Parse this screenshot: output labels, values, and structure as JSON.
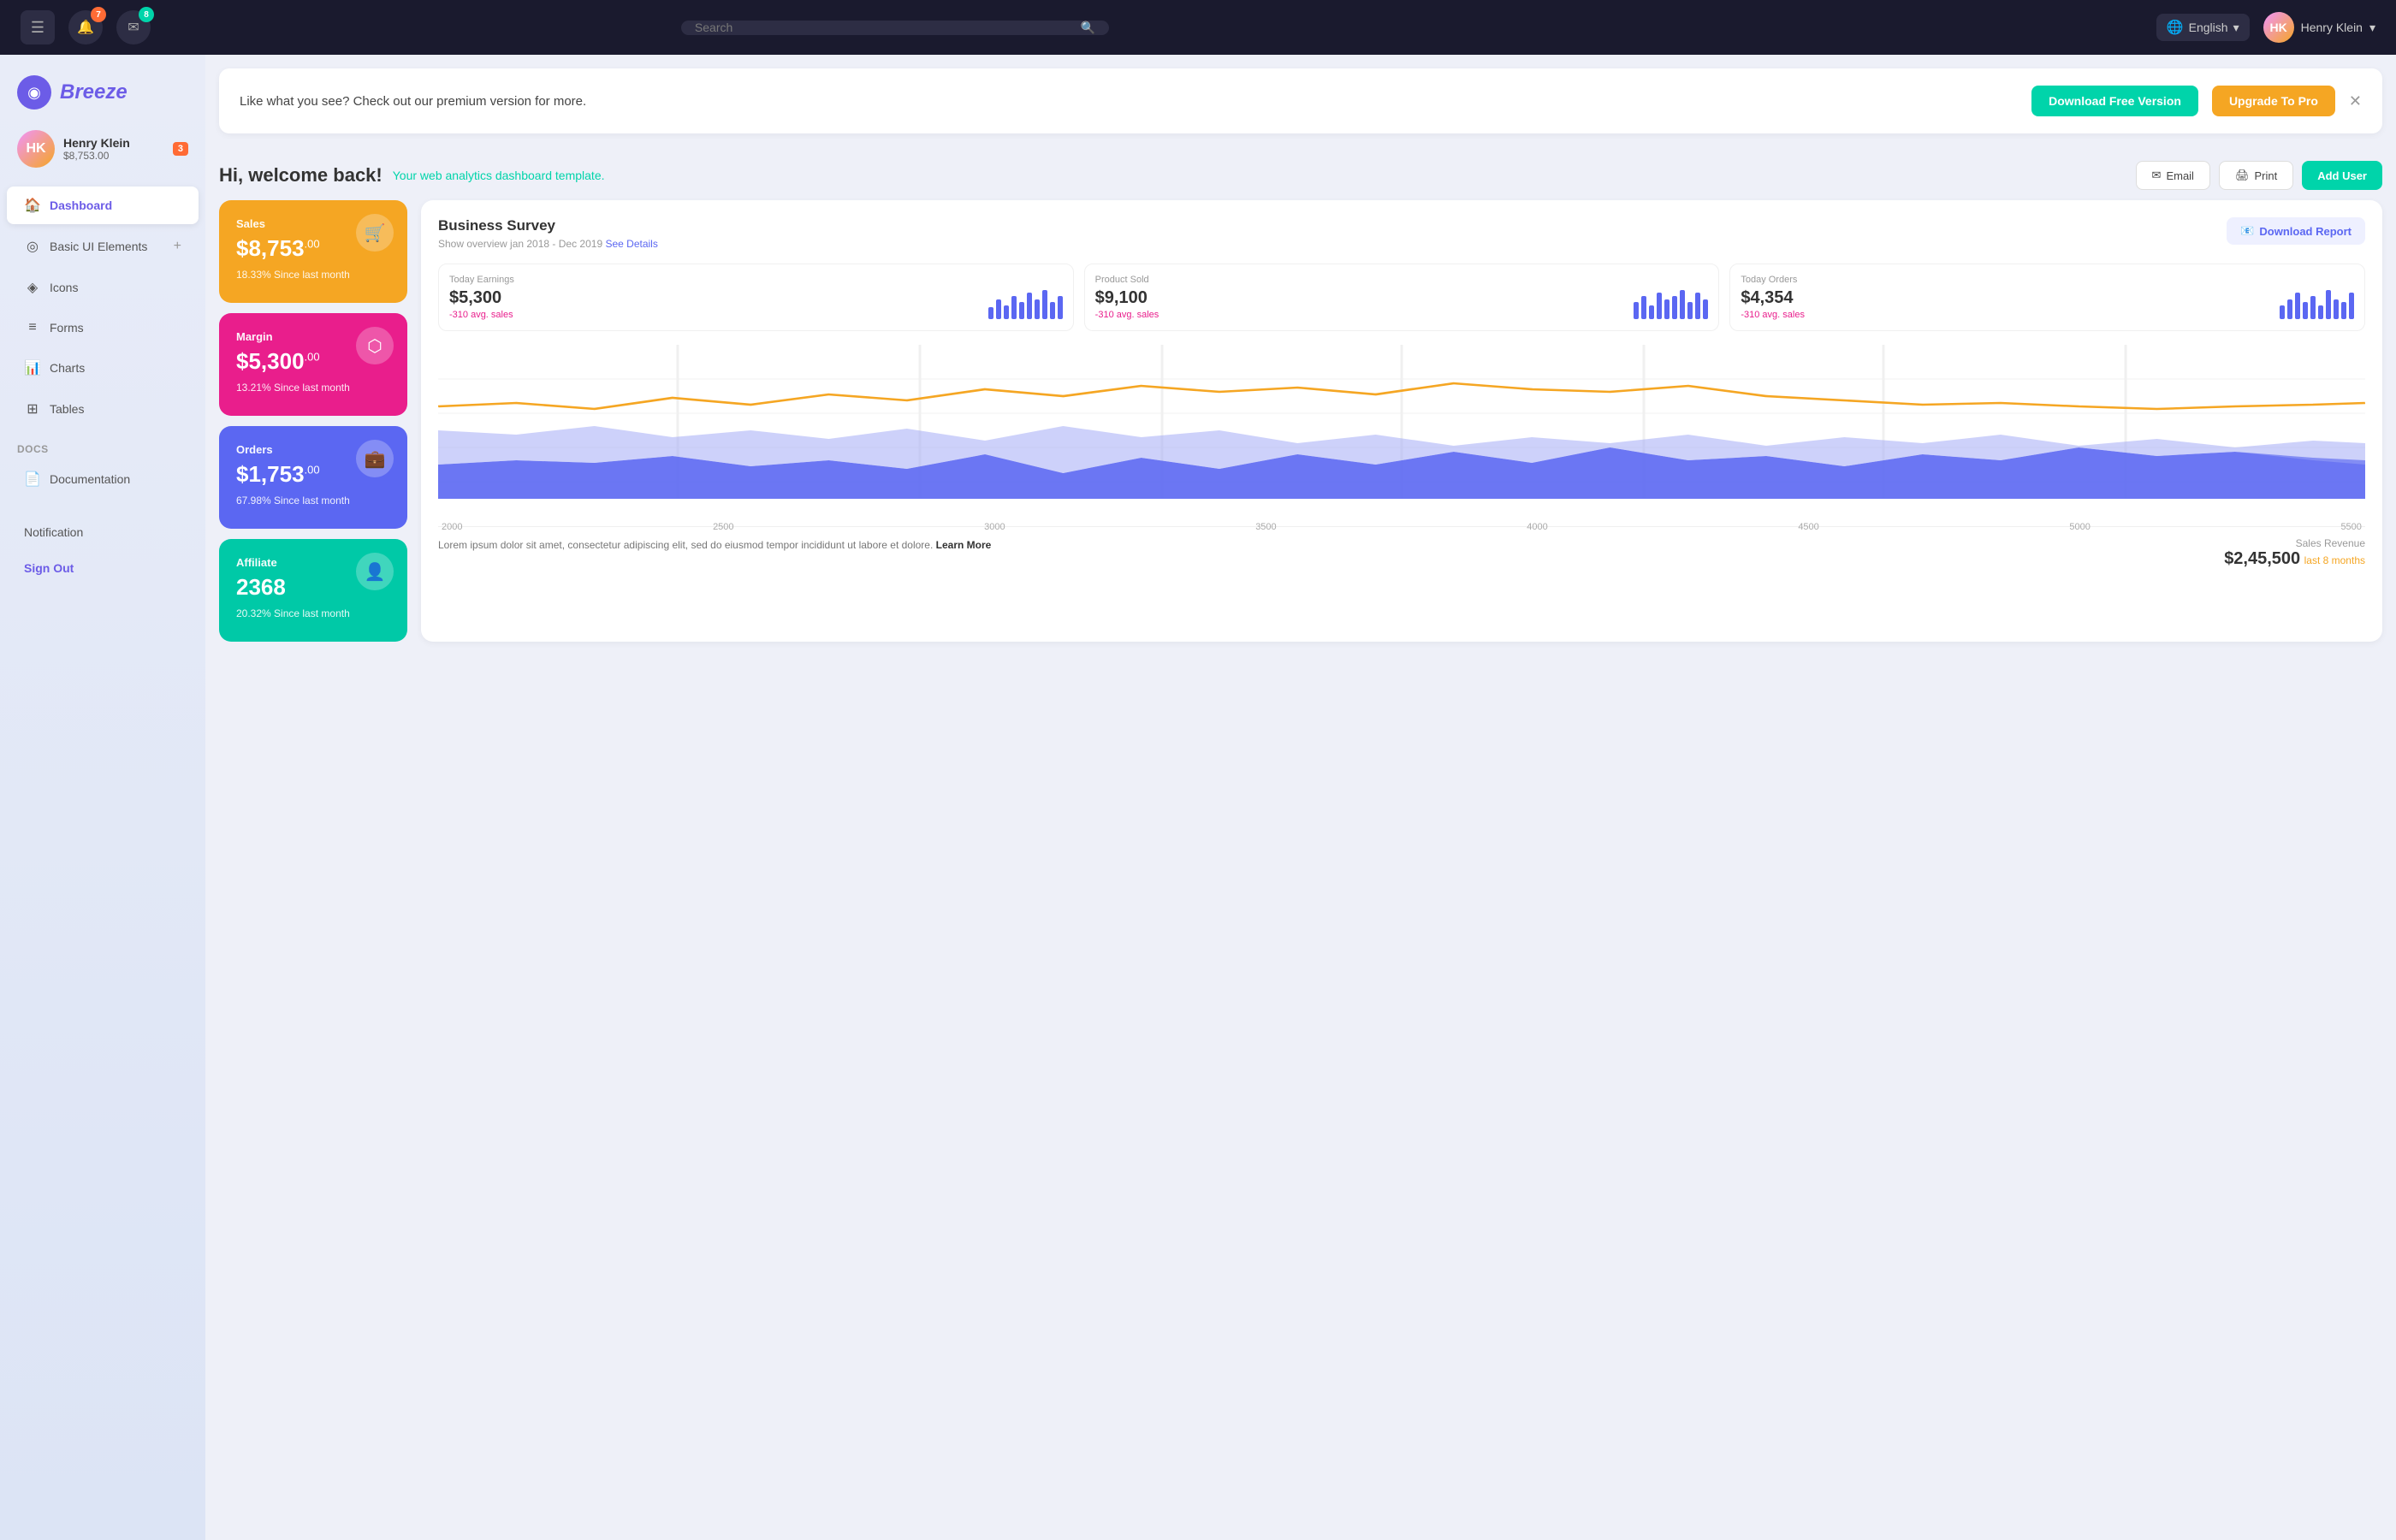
{
  "topNav": {
    "searchPlaceholder": "Search",
    "language": "English",
    "userName": "Henry Klein",
    "notifBadge": "7",
    "mailBadge": "8"
  },
  "sidebar": {
    "logoText": "Breeze",
    "user": {
      "name": "Henry Klein",
      "amount": "$8,753.00",
      "badgeCount": "3",
      "initials": "HK"
    },
    "navItems": [
      {
        "id": "dashboard",
        "label": "Dashboard",
        "icon": "🏠",
        "active": true
      },
      {
        "id": "basic-ui",
        "label": "Basic UI Elements",
        "icon": "◎",
        "active": false,
        "hasAdd": true
      },
      {
        "id": "icons",
        "label": "Icons",
        "icon": "◈",
        "active": false
      },
      {
        "id": "forms",
        "label": "Forms",
        "icon": "≡",
        "active": false
      },
      {
        "id": "charts",
        "label": "Charts",
        "icon": "📊",
        "active": false
      },
      {
        "id": "tables",
        "label": "Tables",
        "icon": "⊞",
        "active": false
      }
    ],
    "docsSectionLabel": "Docs",
    "docsItems": [
      {
        "id": "documentation",
        "label": "Documentation",
        "icon": "📄"
      }
    ],
    "notificationLabel": "Notification",
    "signOutLabel": "Sign Out"
  },
  "promoBanner": {
    "text": "Like what you see? Check out our premium version for more.",
    "downloadFreeBtn": "Download Free Version",
    "upgradeProBtn": "Upgrade To Pro"
  },
  "welcome": {
    "title": "Hi, welcome back!",
    "subtitle": "Your web analytics dashboard template.",
    "emailBtn": "Email",
    "printBtn": "Print",
    "addUserBtn": "Add User"
  },
  "statCards": [
    {
      "id": "sales",
      "label": "Sales",
      "value": "$8,753",
      "cents": ".00",
      "change": "18.33% Since last month",
      "color": "sales",
      "icon": "🛒"
    },
    {
      "id": "margin",
      "label": "Margin",
      "value": "$5,300",
      "cents": ".00",
      "change": "13.21% Since last month",
      "color": "margin",
      "icon": "⬡"
    },
    {
      "id": "orders",
      "label": "Orders",
      "value": "$1,753",
      "cents": ".00",
      "change": "67.98% Since last month",
      "color": "orders",
      "icon": "💼"
    },
    {
      "id": "affiliate",
      "label": "Affiliate",
      "value": "2368",
      "cents": "",
      "change": "20.32% Since last month",
      "color": "affiliate",
      "icon": "👤"
    }
  ],
  "businessSurvey": {
    "title": "Business Survey",
    "subtitle": "Show overview jan 2018 - Dec 2019",
    "seeDetailsLink": "See Details",
    "downloadReportBtn": "Download Report",
    "miniStats": [
      {
        "label": "Today Earnings",
        "value": "$5,300",
        "change": "-310 avg. sales",
        "bars": [
          3,
          6,
          4,
          7,
          5,
          8,
          6,
          9,
          5,
          7
        ]
      },
      {
        "label": "Product Sold",
        "value": "$9,100",
        "change": "-310 avg. sales",
        "bars": [
          5,
          7,
          4,
          8,
          6,
          7,
          9,
          5,
          8,
          6
        ]
      },
      {
        "label": "Today Orders",
        "value": "$4,354",
        "change": "-310 avg. sales",
        "bars": [
          4,
          6,
          8,
          5,
          7,
          4,
          9,
          6,
          5,
          8
        ]
      }
    ],
    "chartXLabels": [
      "2000",
      "2500",
      "3000",
      "3500",
      "4000",
      "4500",
      "5000",
      "5500"
    ],
    "footerText": "Lorem ipsum dolor sit amet, consectetur adipiscing elit, sed do eiusmod tempor incididunt ut labore et dolore.",
    "learnMoreLink": "Learn More",
    "salesRevenueLabel": "Sales Revenue",
    "salesRevenueValue": "$2,45,500",
    "salesRevenueSub": "last 8 months"
  }
}
